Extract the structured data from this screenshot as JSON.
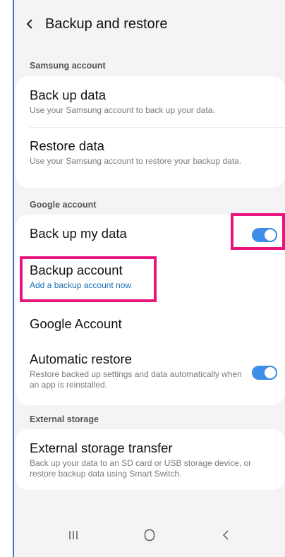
{
  "header": {
    "title": "Backup and restore"
  },
  "sections": {
    "samsung": "Samsung account",
    "google": "Google account",
    "external": "External storage"
  },
  "samsung_items": [
    {
      "title": "Back up data",
      "subtitle": "Use your Samsung account to back up your data."
    },
    {
      "title": "Restore data",
      "subtitle": "Use your Samsung account to restore your backup data."
    }
  ],
  "google_items": {
    "backup_my_data": {
      "title": "Back up my data",
      "toggle_on": true
    },
    "backup_account": {
      "title": "Backup account",
      "subtitle": "Add a backup account now"
    },
    "google_account": {
      "title": "Google Account"
    },
    "automatic_restore": {
      "title": "Automatic restore",
      "subtitle": "Restore backed up settings and data automatically when an app is reinstalled.",
      "toggle_on": true
    }
  },
  "external_items": [
    {
      "title": "External storage transfer",
      "subtitle": "Back up your data to an SD card or USB storage device, or restore backup data using Smart Switch."
    }
  ],
  "navbar": [
    "recent-apps",
    "home",
    "back"
  ],
  "colors": {
    "accent": "#3e8ee8",
    "highlight": "#e9157c",
    "link": "#1a6fb5",
    "frame": "#3a73c8"
  }
}
